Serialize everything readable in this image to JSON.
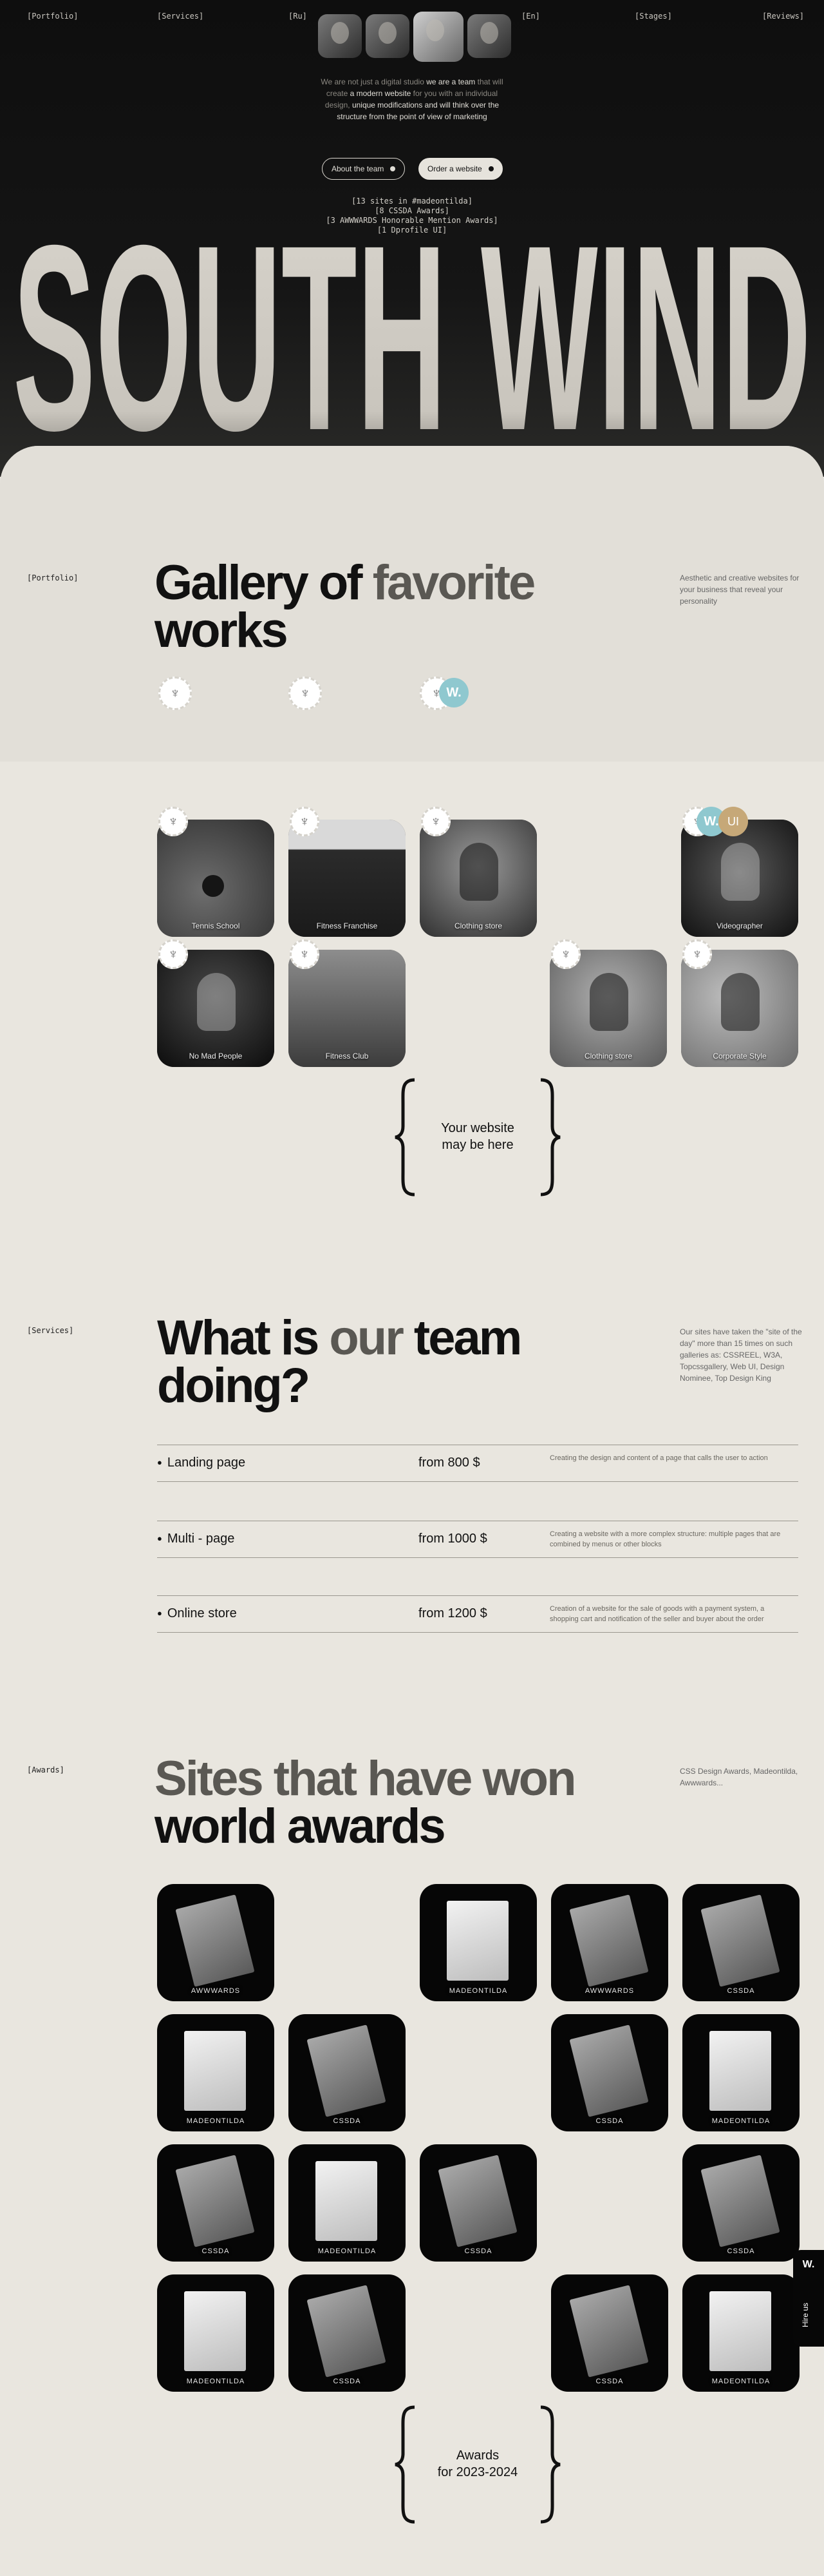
{
  "nav": {
    "portfolio": "[Portfolio]",
    "services": "[Services]",
    "ru": "[Ru]",
    "en": "[En]",
    "stages": "[Stages]",
    "reviews": "[Reviews]"
  },
  "hero": {
    "intro": [
      "We are not just a digital studio ",
      "we are a team",
      " that will create ",
      "a modern website",
      " for you with an individual design, ",
      "unique modifications",
      " and will think over the structure from the point of view of marketing"
    ],
    "about_button": "About the team",
    "order_button": "Order a website",
    "stats": [
      "[13 sites in #madeontilda]",
      "[8 CSSDA Awards]",
      "[3 AWWWARDS Honorable Mention Awards]",
      "[1 Dprofile UI]"
    ],
    "title": "SOUTH WIND"
  },
  "portfolio": {
    "tag": "[Portfolio]",
    "title_1": "Gallery of ",
    "title_accent": "favorite",
    "title_2": "works",
    "side": "Aesthetic and creative websites for your business that reveal your personality",
    "badge_w": "W.",
    "badge_ui": "UI",
    "cards": [
      "Tennis School",
      "Fitness Franchise",
      "Clothing store",
      "Videographer",
      "No Mad People",
      "Fitness Club",
      "Clothing store",
      "Corporate Style"
    ],
    "placeholder_1": "Your website",
    "placeholder_2": "may be here"
  },
  "services": {
    "tag": "[Services]",
    "title_1": "What is ",
    "title_accent": "our",
    "title_2": " team",
    "title_3": "doing?",
    "side": "Our sites have taken the \"site of the day\" more than 15 times on such galleries as: CSSREEL, W3A, Topcssgallery, Web UI, Design Nominee, Top Design King",
    "rows": [
      {
        "name": "Landing page",
        "price": "from 800 $",
        "desc": "Creating the design and content of a page that calls the user to action"
      },
      {
        "name": "Multi - page",
        "price": "from 1000 $",
        "desc": "Creating a website with a more complex structure: multiple pages that are combined by menus or other blocks"
      },
      {
        "name": "Online store",
        "price": "from 1200 $",
        "desc": "Creation of a website for the sale of goods with a payment system, a shopping cart and notification of the seller and buyer about the order"
      }
    ]
  },
  "awards": {
    "tag": "[Awards]",
    "title_1": "Sites that have won",
    "title_2": "world awards",
    "side": "CSS Design Awards, Madeontilda, Awwwards...",
    "labels": [
      "AWWWARDS",
      "MADEONTILDA",
      "AWWWARDS",
      "CSSDA",
      "MADEONTILDA",
      "CSSDA",
      "CSSDA",
      "MADEONTILDA",
      "CSSDA",
      "MADEONTILDA",
      "CSSDA",
      "CSSDA",
      "MADEONTILDA",
      "CSSDA",
      "CSSDA",
      "MADEONTILDA"
    ],
    "footer_1": "Awards",
    "footer_2": "for 2023-2024"
  },
  "hirus": {
    "logo": "W.",
    "label": "Hire us"
  }
}
